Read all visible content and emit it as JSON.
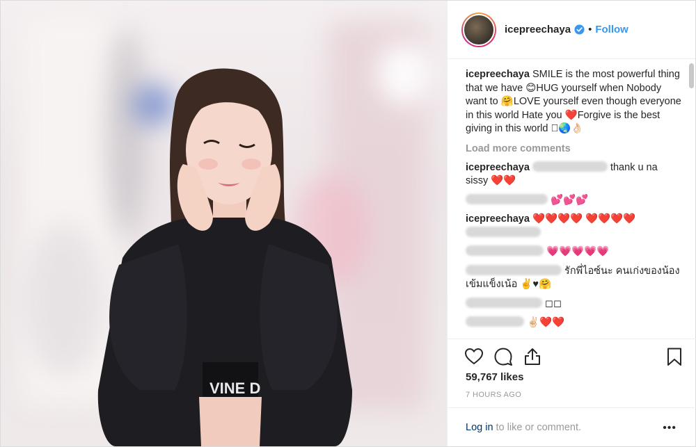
{
  "post": {
    "username": "icepreechaya",
    "follow_label": "Follow",
    "separator": "•",
    "caption": {
      "username": "icepreechaya",
      "text": "SMILE is the most powerful thing that we have 😊HUG yourself when Nobody want to 🤗LOVE yourself even though everyone in this world Hate you ❤️Forgive is the best giving in this world 🏻🌏👌🏻"
    },
    "load_more_label": "Load more comments",
    "comments": [
      {
        "username": "icepreechaya",
        "text": "thank u na sissy ❤️❤️"
      },
      {
        "username": "",
        "text": "💕💕💕"
      },
      {
        "username": "icepreechaya",
        "text": "❤️❤️❤️❤️ ❤️❤️❤️❤️"
      },
      {
        "username": "",
        "text": "💗💗💗💗💗"
      },
      {
        "username": "",
        "text": "รักพี่ไอซ์นะ คนเก่งของน้อง เข้มแข็งเน้อ ✌️♥🤗"
      },
      {
        "username": "",
        "text": "◻◻"
      },
      {
        "username": "",
        "text": "✌🏻❤️❤️"
      }
    ],
    "likes": "59,767 likes",
    "timestamp": "7 HOURS AGO",
    "login_link": "Log in",
    "login_rest": "to like or comment.",
    "more_label": "•••",
    "icons": [
      "verified-icon",
      "heart-icon",
      "comment-icon",
      "share-icon",
      "bookmark-icon"
    ],
    "colors": {
      "link": "#3897f0",
      "muted": "#999999",
      "heart": "#e0245e"
    }
  }
}
